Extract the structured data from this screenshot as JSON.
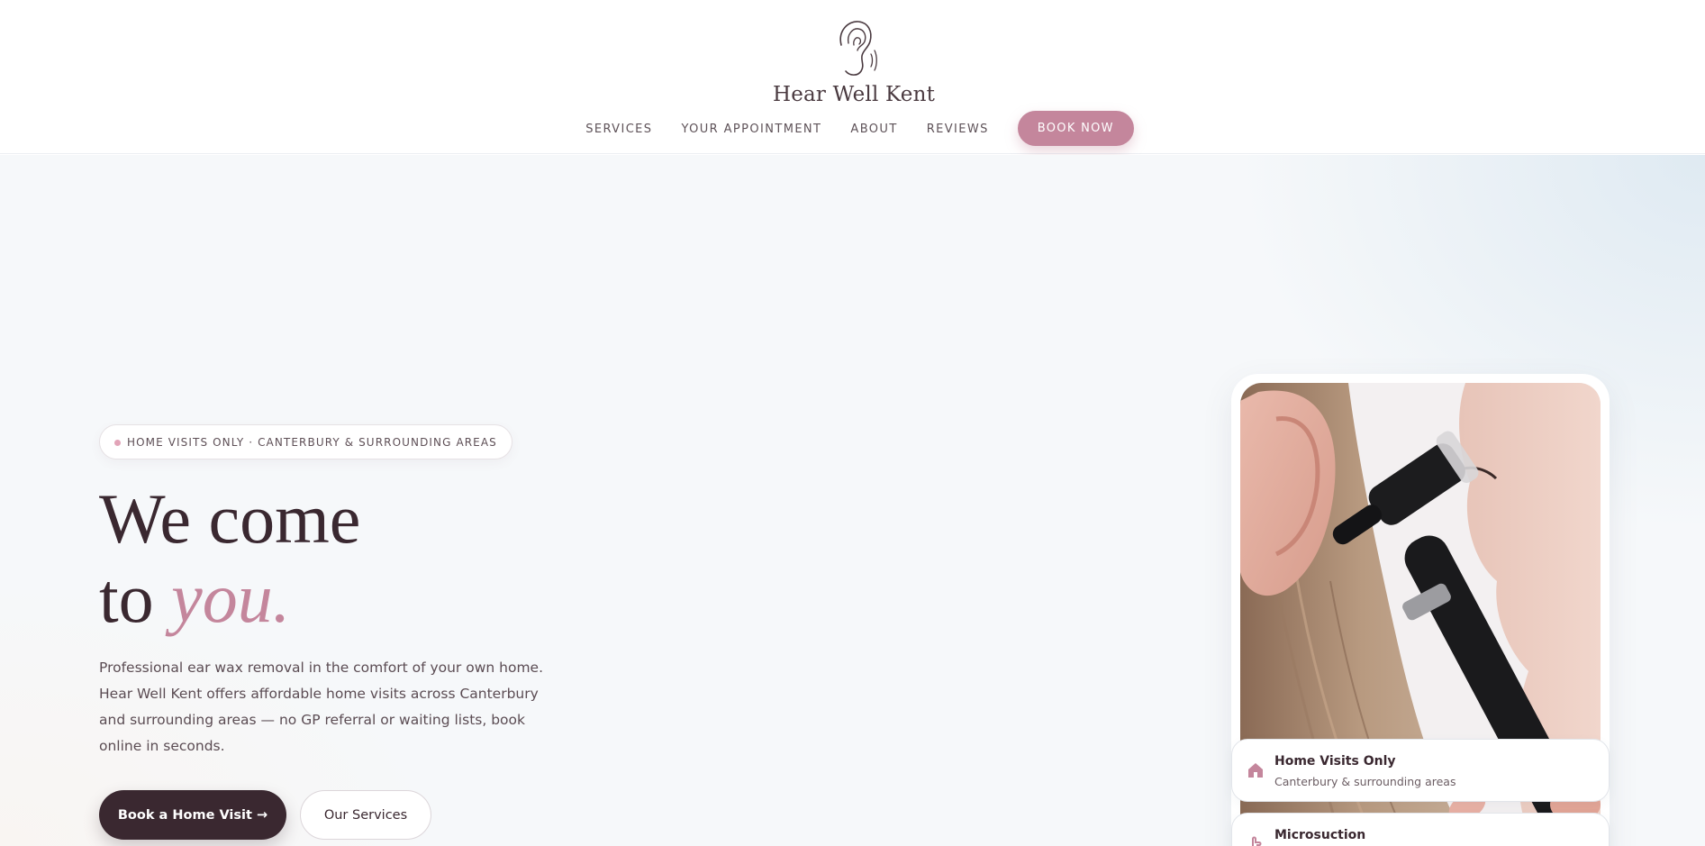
{
  "brand": {
    "name": "Hear Well Kent",
    "logo_icon": "ear-icon"
  },
  "nav": {
    "items": [
      {
        "label": "SERVICES"
      },
      {
        "label": "YOUR APPOINTMENT"
      },
      {
        "label": "ABOUT"
      },
      {
        "label": "REVIEWS"
      }
    ],
    "cta_label": "BOOK NOW"
  },
  "hero": {
    "badge": "HOME VISITS ONLY · CANTERBURY & SURROUNDING AREAS",
    "headline_line1": "We come",
    "headline_line2_prefix": "to",
    "headline_accent": "you.",
    "lead": "Professional ear wax removal in the comfort of your own home. Hear Well Kent offers affordable home visits across Canterbury and surrounding areas — no GP referral or waiting lists, book online in seconds.",
    "primary_button": "Book a Home Visit →",
    "secondary_button": "Our Services"
  },
  "photo": {
    "subject": "otoscope ear examination"
  },
  "features": [
    {
      "title": "Home Visits Only",
      "subtitle": "Canterbury & surrounding areas",
      "icon": "home-icon"
    },
    {
      "title": "Microsuction",
      "subtitle": "",
      "icon": "hand-icon"
    }
  ],
  "colors": {
    "accent": "#c4869c",
    "dark": "#3a2830",
    "text": "#5b4c53",
    "background": "#f6f8fa"
  }
}
